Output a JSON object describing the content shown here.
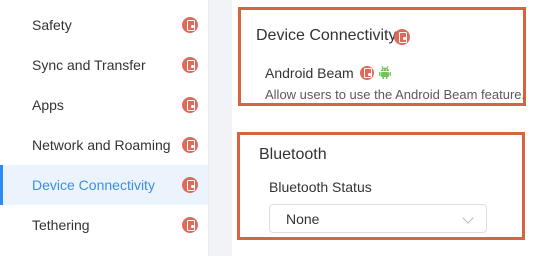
{
  "sidebar": {
    "items": [
      {
        "label": "Safety",
        "active": false
      },
      {
        "label": "Sync and Transfer",
        "active": false
      },
      {
        "label": "Apps",
        "active": false
      },
      {
        "label": "Network and Roaming",
        "active": false
      },
      {
        "label": "Device Connectivity",
        "active": true
      },
      {
        "label": "Tethering",
        "active": false
      }
    ]
  },
  "device_connectivity": {
    "title": "Device Connectivity",
    "android_beam": {
      "label": "Android Beam",
      "description": "Allow users to use the Android Beam feature."
    }
  },
  "bluetooth": {
    "title": "Bluetooth",
    "status_label": "Bluetooth Status",
    "status_value": "None"
  },
  "colors": {
    "accent": "#2d8cf0",
    "policy_icon": "#e06a5a",
    "highlight_border": "#d8643f",
    "android_green": "#78c257"
  },
  "icons": {
    "policy": "phone-policy-icon",
    "android": "android-icon",
    "chevron": "chevron-down-icon"
  }
}
